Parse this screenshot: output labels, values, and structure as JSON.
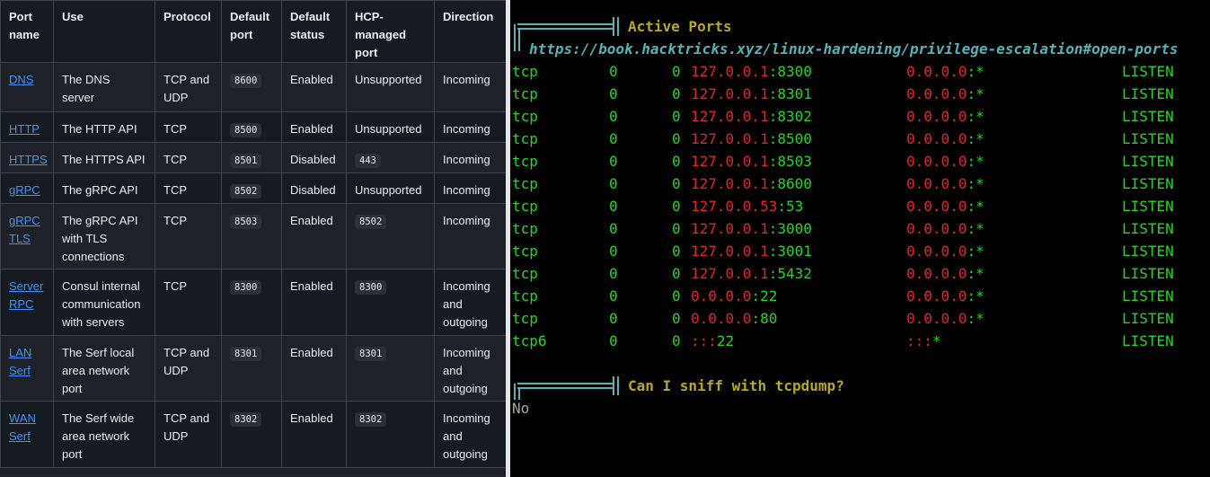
{
  "table": {
    "headers": [
      {
        "l1": "Port",
        "l2": "name",
        "l3": ""
      },
      {
        "l1": "Use",
        "l2": "",
        "l3": ""
      },
      {
        "l1": "Protocol",
        "l2": "",
        "l3": ""
      },
      {
        "l1": "Default",
        "l2": "port",
        "l3": ""
      },
      {
        "l1": "Default",
        "l2": "status",
        "l3": ""
      },
      {
        "l1": "HCP-",
        "l2": "managed",
        "l3": "port"
      },
      {
        "l1": "Direction",
        "l2": "",
        "l3": ""
      }
    ],
    "rows": [
      {
        "name": [
          "DNS"
        ],
        "use": [
          "The DNS server"
        ],
        "protocol": [
          "TCP and",
          "UDP"
        ],
        "port": "8600",
        "status": "Enabled",
        "hcp": {
          "code": false,
          "text": "Unsupported"
        },
        "direction": [
          "Incoming"
        ]
      },
      {
        "name": [
          "HTTP"
        ],
        "use": [
          "The HTTP API"
        ],
        "protocol": [
          "TCP"
        ],
        "port": "8500",
        "status": "Enabled",
        "hcp": {
          "code": false,
          "text": "Unsupported"
        },
        "direction": [
          "Incoming"
        ]
      },
      {
        "name": [
          "HTTPS"
        ],
        "use": [
          "The HTTPS API"
        ],
        "protocol": [
          "TCP"
        ],
        "port": "8501",
        "status": "Disabled",
        "hcp": {
          "code": true,
          "text": "443"
        },
        "direction": [
          "Incoming"
        ]
      },
      {
        "name": [
          "gRPC"
        ],
        "use": [
          "The gRPC API"
        ],
        "protocol": [
          "TCP"
        ],
        "port": "8502",
        "status": "Disabled",
        "hcp": {
          "code": false,
          "text": "Unsupported"
        },
        "direction": [
          "Incoming"
        ]
      },
      {
        "name": [
          "gRPC",
          "TLS"
        ],
        "use": [
          "The gRPC API",
          "with TLS",
          "connections"
        ],
        "protocol": [
          "TCP"
        ],
        "port": "8503",
        "status": "Enabled",
        "hcp": {
          "code": true,
          "text": "8502"
        },
        "direction": [
          "Incoming"
        ]
      },
      {
        "name": [
          "Server",
          "RPC"
        ],
        "use": [
          "Consul internal",
          "communication",
          "with servers"
        ],
        "protocol": [
          "TCP"
        ],
        "port": "8300",
        "status": "Enabled",
        "hcp": {
          "code": true,
          "text": "8300"
        },
        "direction": [
          "Incoming",
          "and",
          "outgoing"
        ]
      },
      {
        "name": [
          "LAN",
          "Serf"
        ],
        "use": [
          "The Serf local",
          "area network",
          "port"
        ],
        "protocol": [
          "TCP and",
          "UDP"
        ],
        "port": "8301",
        "status": "Enabled",
        "hcp": {
          "code": true,
          "text": "8301"
        },
        "direction": [
          "Incoming",
          "and",
          "outgoing"
        ]
      },
      {
        "name": [
          "WAN",
          "Serf"
        ],
        "use": [
          "The Serf wide",
          "area network",
          "port"
        ],
        "protocol": [
          "TCP and",
          "UDP"
        ],
        "port": "8302",
        "status": "Enabled",
        "hcp": {
          "code": true,
          "text": "8302"
        },
        "direction": [
          "Incoming",
          "and",
          "outgoing"
        ]
      }
    ]
  },
  "terminal": {
    "section1_title": "Active Ports",
    "section1_link": "https://book.hacktricks.xyz/linux-hardening/privilege-escalation#open-ports",
    "ports": [
      {
        "proto": "tcp",
        "recv": "0",
        "send": "0",
        "local_ip": "127.0.0.1",
        "local_port": ":8300",
        "foreign_ip": "0.0.0.0",
        "foreign_port": ":*",
        "state": "LISTEN"
      },
      {
        "proto": "tcp",
        "recv": "0",
        "send": "0",
        "local_ip": "127.0.0.1",
        "local_port": ":8301",
        "foreign_ip": "0.0.0.0",
        "foreign_port": ":*",
        "state": "LISTEN"
      },
      {
        "proto": "tcp",
        "recv": "0",
        "send": "0",
        "local_ip": "127.0.0.1",
        "local_port": ":8302",
        "foreign_ip": "0.0.0.0",
        "foreign_port": ":*",
        "state": "LISTEN"
      },
      {
        "proto": "tcp",
        "recv": "0",
        "send": "0",
        "local_ip": "127.0.0.1",
        "local_port": ":8500",
        "foreign_ip": "0.0.0.0",
        "foreign_port": ":*",
        "state": "LISTEN"
      },
      {
        "proto": "tcp",
        "recv": "0",
        "send": "0",
        "local_ip": "127.0.0.1",
        "local_port": ":8503",
        "foreign_ip": "0.0.0.0",
        "foreign_port": ":*",
        "state": "LISTEN"
      },
      {
        "proto": "tcp",
        "recv": "0",
        "send": "0",
        "local_ip": "127.0.0.1",
        "local_port": ":8600",
        "foreign_ip": "0.0.0.0",
        "foreign_port": ":*",
        "state": "LISTEN"
      },
      {
        "proto": "tcp",
        "recv": "0",
        "send": "0",
        "local_ip": "127.0.0.53",
        "local_port": ":53",
        "foreign_ip": "0.0.0.0",
        "foreign_port": ":*",
        "state": "LISTEN"
      },
      {
        "proto": "tcp",
        "recv": "0",
        "send": "0",
        "local_ip": "127.0.0.1",
        "local_port": ":3000",
        "foreign_ip": "0.0.0.0",
        "foreign_port": ":*",
        "state": "LISTEN"
      },
      {
        "proto": "tcp",
        "recv": "0",
        "send": "0",
        "local_ip": "127.0.0.1",
        "local_port": ":3001",
        "foreign_ip": "0.0.0.0",
        "foreign_port": ":*",
        "state": "LISTEN"
      },
      {
        "proto": "tcp",
        "recv": "0",
        "send": "0",
        "local_ip": "127.0.0.1",
        "local_port": ":5432",
        "foreign_ip": "0.0.0.0",
        "foreign_port": ":*",
        "state": "LISTEN"
      },
      {
        "proto": "tcp",
        "recv": "0",
        "send": "0",
        "local_ip": "0.0.0.0",
        "local_port": ":22",
        "foreign_ip": "0.0.0.0",
        "foreign_port": ":*",
        "state": "LISTEN"
      },
      {
        "proto": "tcp",
        "recv": "0",
        "send": "0",
        "local_ip": "0.0.0.0",
        "local_port": ":80",
        "foreign_ip": "0.0.0.0",
        "foreign_port": ":*",
        "state": "LISTEN"
      },
      {
        "proto": "tcp6",
        "recv": "0",
        "send": "0",
        "local_ip": ":::",
        "local_port": "22",
        "foreign_ip": ":::",
        "foreign_port": "*",
        "state": "LISTEN"
      }
    ],
    "section2_title": "Can I sniff with tcpdump?",
    "section2_answer": "No"
  },
  "colors": {
    "terminal_green": "#26d526",
    "terminal_red": "#e0262b",
    "terminal_yellow": "#b7a72e",
    "terminal_cyan": "#5ab1b6",
    "link_blue": "#4493f8"
  }
}
